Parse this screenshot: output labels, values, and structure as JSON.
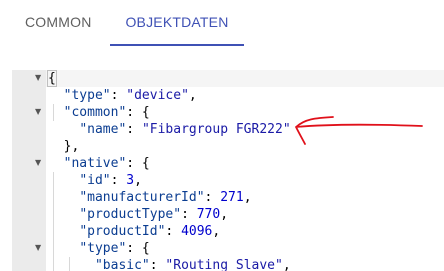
{
  "tabs": [
    {
      "label": "COMMON",
      "active": false
    },
    {
      "label": "OBJEKTDATEN",
      "active": true
    }
  ],
  "accent_color": "#3f51b5",
  "annotation_color": "#e0101a",
  "json_lines": [
    {
      "p": "",
      "k": "",
      "v": "",
      "t": "",
      "s": "{"
    },
    {
      "p": "  ",
      "k": "\"type\"",
      "v": "\"device\"",
      "t": "str",
      "s": ","
    },
    {
      "p": "  ",
      "k": "\"common\"",
      "v": "",
      "t": "",
      "s": ": {"
    },
    {
      "p": "    ",
      "k": "\"name\"",
      "v": "\"Fibargroup FGR222\"",
      "t": "str",
      "s": ""
    },
    {
      "p": "  ",
      "k": "",
      "v": "",
      "t": "",
      "s": "},"
    },
    {
      "p": "  ",
      "k": "\"native\"",
      "v": "",
      "t": "",
      "s": ": {"
    },
    {
      "p": "    ",
      "k": "\"id\"",
      "v": "3",
      "t": "num",
      "s": ","
    },
    {
      "p": "    ",
      "k": "\"manufacturerId\"",
      "v": "271",
      "t": "num",
      "s": ","
    },
    {
      "p": "    ",
      "k": "\"productType\"",
      "v": "770",
      "t": "num",
      "s": ","
    },
    {
      "p": "    ",
      "k": "\"productId\"",
      "v": "4096",
      "t": "num",
      "s": ","
    },
    {
      "p": "    ",
      "k": "\"type\"",
      "v": "",
      "t": "",
      "s": ": {"
    },
    {
      "p": "      ",
      "k": "\"basic\"",
      "v": "\"Routing Slave\"",
      "t": "str",
      "s": ","
    }
  ]
}
